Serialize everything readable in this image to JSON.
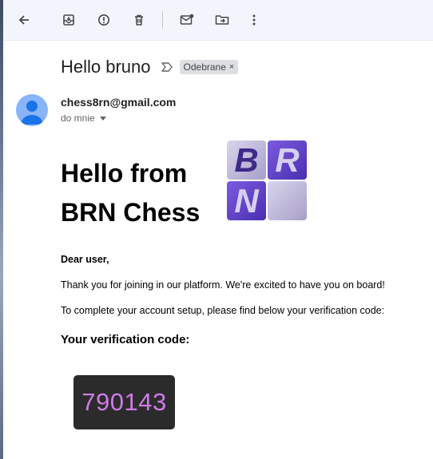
{
  "toolbar": {
    "items": [
      "back-icon",
      "archive-icon",
      "report-spam-icon",
      "delete-icon",
      "mark-unread-icon",
      "move-to-icon",
      "more-icon"
    ]
  },
  "email": {
    "subject": "Hello bruno",
    "label_chip": "Odebrane",
    "label_chip_close": "×",
    "sender": "chess8rn@gmail.com",
    "recipient": "do mnie",
    "headline_line1": "Hello from",
    "headline_line2": "BRN Chess",
    "logo_letters": [
      "B",
      "R",
      "N"
    ],
    "greeting": "Dear user,",
    "paragraph1": "Thank you for joining in our platform. We're excited to have you on board!",
    "paragraph2": "To complete your account setup, please find below your verification code:",
    "code_heading": "Your verification code:",
    "verification_code": "790143"
  },
  "colors": {
    "toolbar_bg": "#f2f6fc",
    "chip_bg": "#dddfe2",
    "avatar": "#8ab4f8",
    "code_bg": "#2b2b2b",
    "code_text": "#d07be8",
    "logo_dark": "#5b3fc4",
    "logo_light": "#c8c3dc"
  }
}
